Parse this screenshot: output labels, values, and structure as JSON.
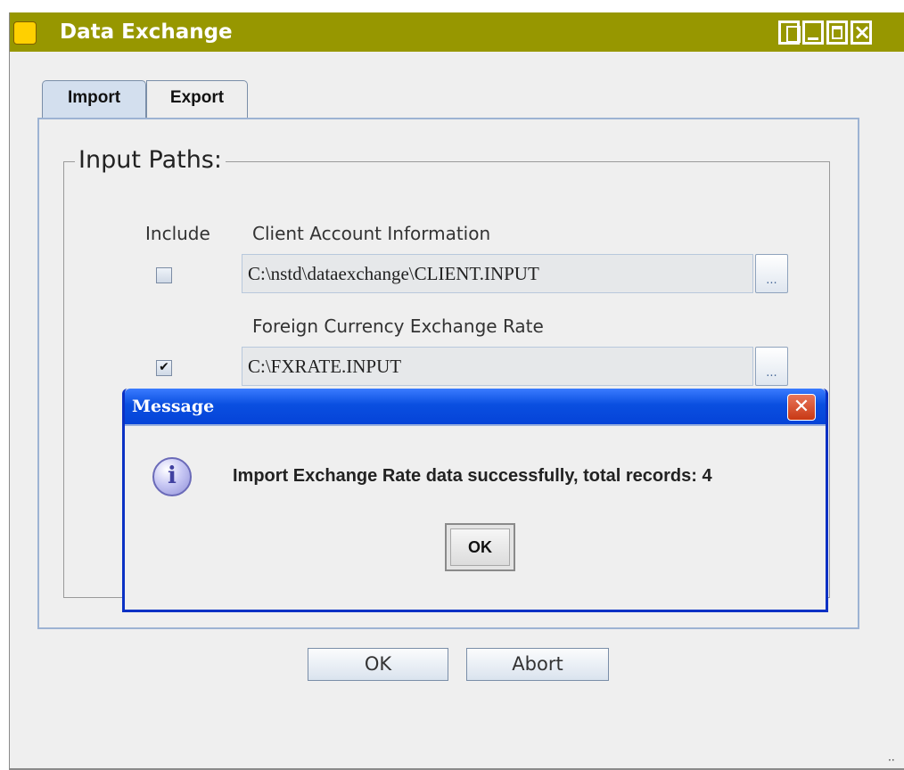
{
  "window": {
    "title": "Data Exchange",
    "colors": {
      "titlebar": "#979700",
      "background": "#efefef"
    }
  },
  "tabs": [
    {
      "label": "Import",
      "selected": true
    },
    {
      "label": "Export",
      "selected": false
    }
  ],
  "input_paths": {
    "legend": "Input Paths:",
    "include_header": "Include",
    "items": [
      {
        "label": "Client Account Information",
        "included": false,
        "path": "C:\\nstd\\dataexchange\\CLIENT.INPUT",
        "browse_label": "..."
      },
      {
        "label": "Foreign Currency Exchange Rate",
        "included": true,
        "path": "C:\\FXRATE.INPUT",
        "browse_label": "..."
      }
    ]
  },
  "buttons": {
    "ok": "OK",
    "abort": "Abort"
  },
  "dialog": {
    "title": "Message",
    "close_glyph": "✕",
    "icon": "info-icon",
    "message": "Import Exchange Rate data successfully, total records: 4",
    "ok": "OK",
    "colors": {
      "titlebar": "#0a4fe0",
      "close": "#c83814"
    }
  }
}
